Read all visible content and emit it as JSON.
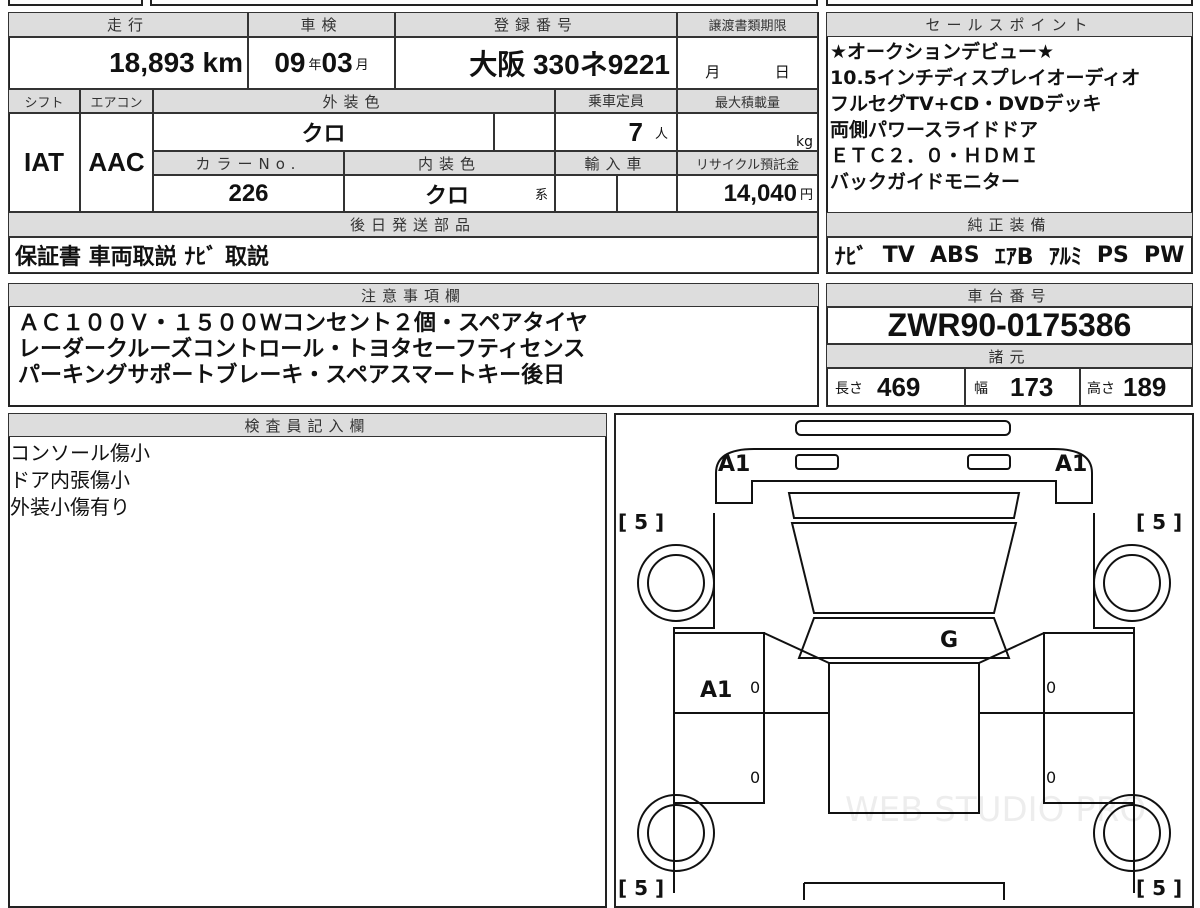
{
  "vehicle": {
    "mileage_label": "走行",
    "mileage": "18,893",
    "mileage_unit": "km",
    "inspection_label": "車検",
    "insp_year": "09",
    "year_unit": "年",
    "insp_month": "03",
    "month_unit": "月",
    "reg_label": "登録番号",
    "reg_number": "大阪 330ネ9221",
    "transfer_label": "譲渡書類期限",
    "transfer_month": "月",
    "transfer_day": "日",
    "shift_label": "シフト",
    "shift": "IAT",
    "ac_label": "エアコン",
    "ac": "AAC",
    "ext_color_label": "外装色",
    "ext_color": "クロ",
    "seats_label": "乗車定員",
    "seats": "7",
    "seats_unit": "人",
    "maxload_label": "最大積載量",
    "maxload_unit": "kg",
    "color_no_label": "カラーNo.",
    "color_no": "226",
    "int_color_label": "内装色",
    "int_color": "クロ",
    "int_suffix": "系",
    "import_label": "輸入車",
    "recycle_label": "リサイクル預託金",
    "recycle": "14,040",
    "recycle_unit": "円",
    "later_parts_label": "後日発送部品",
    "later_parts": "保証書 車両取説 ﾅﾋﾞ 取説"
  },
  "sales_points": {
    "label": "セールスポイント",
    "lines": [
      "★オークションデビュー★",
      "10.5インチディスプレイオーディオ",
      "フルセグTV+CD・DVDデッキ",
      "両側パワースライドドア",
      "ＥＴＣ２．０・ＨＤＭＩ",
      "バックガイドモニター"
    ]
  },
  "equipment": {
    "label": "純正装備",
    "items": [
      "ﾅﾋﾞ",
      "TV",
      "ABS",
      "ｴｱB",
      "ｱﾙﾐ",
      "PS",
      "PW"
    ]
  },
  "notes": {
    "label": "注意事項欄",
    "lines": [
      "ＡＣ１００Ｖ・１５００Ｗコンセント２個・スペアタイヤ",
      "レーダークルーズコントロール・トヨタセーフティセンス",
      "パーキングサポートブレーキ・スペアスマートキー後日"
    ]
  },
  "chassis": {
    "label": "車台番号",
    "number": "ZWR90-0175386"
  },
  "specs": {
    "label": "諸元",
    "length_label": "長さ",
    "length": "469",
    "width_label": "幅",
    "width": "173",
    "height_label": "高さ",
    "height": "189"
  },
  "inspector": {
    "label": "検査員記入欄",
    "lines": [
      "コンソール傷小",
      "ドア内張傷小",
      "外装小傷有り"
    ]
  },
  "diagram": {
    "front_left": "A1",
    "front_right": "A1",
    "tire": "[ 5 ]",
    "roof": "G",
    "door_left": "A1",
    "zero": "0",
    "watermark": "WEB STUDIO PRO"
  }
}
